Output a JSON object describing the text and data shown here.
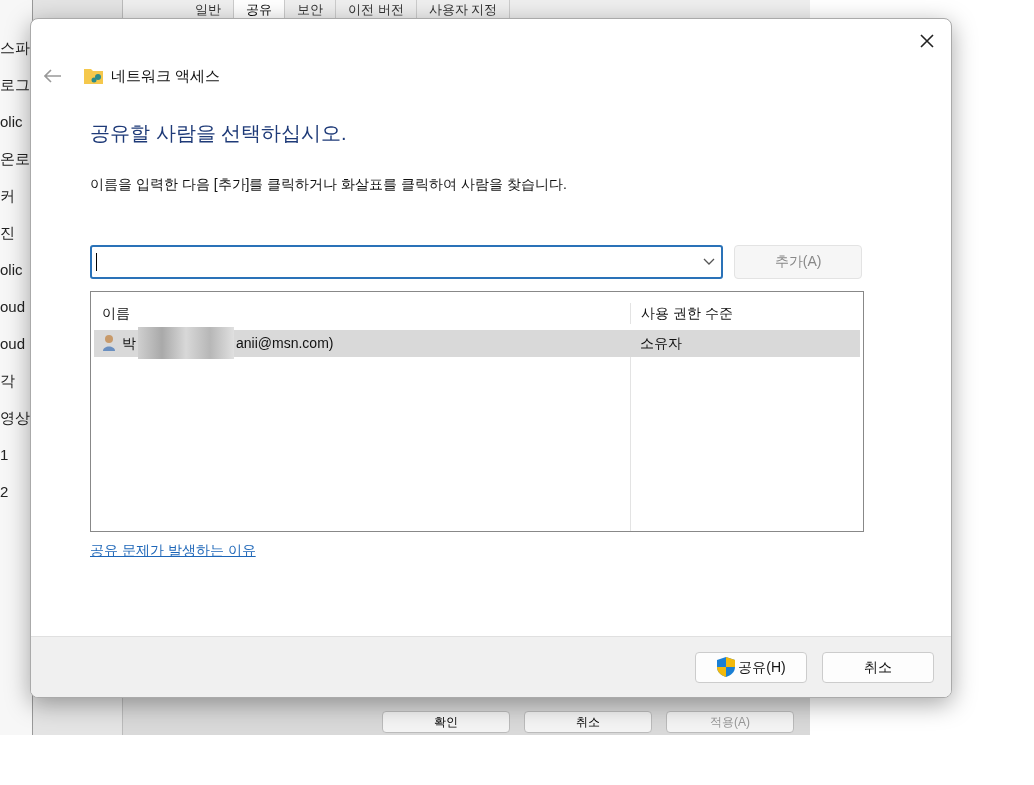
{
  "background_window": {
    "tabs": [
      {
        "label": "일반",
        "selected": false
      },
      {
        "label": "공유",
        "selected": true
      },
      {
        "label": "보안",
        "selected": false
      },
      {
        "label": "이전 버전",
        "selected": false
      },
      {
        "label": "사용자 지정",
        "selected": false
      }
    ],
    "sidebar_items": [
      "스파",
      "로그",
      "olic",
      "온로",
      "커",
      "진",
      "olic",
      "oud",
      "oud",
      "각",
      "영상",
      "1",
      "2"
    ],
    "buttons": [
      {
        "label": "확인",
        "disabled": false
      },
      {
        "label": "취소",
        "disabled": false
      },
      {
        "label": "적용(A)",
        "disabled": true
      }
    ]
  },
  "dialog": {
    "title": "네트워크 액세스",
    "heading": "공유할 사람을 선택하십시오.",
    "description": "이름을 입력한 다음 [추가]를 클릭하거나 화살표를 클릭하여 사람을 찾습니다.",
    "add_button": {
      "label": "추가(A)",
      "disabled": true
    },
    "table": {
      "columns": [
        "이름",
        "사용 권한 수준"
      ],
      "rows": [
        {
          "name_start": "박",
          "name_end": "anii@msn.com)",
          "redacted": true,
          "permission": "소유자",
          "selected": true
        }
      ]
    },
    "help_link": "공유 문제가 발생하는 이유",
    "buttons": [
      {
        "label": "공유(H)",
        "kind": "shield"
      },
      {
        "label": "취소",
        "kind": "plain"
      }
    ]
  }
}
